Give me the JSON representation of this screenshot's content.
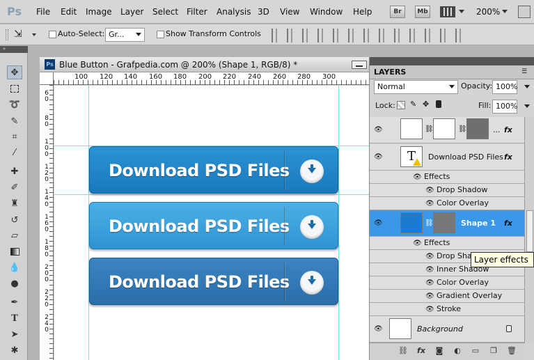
{
  "app": {
    "logo": "Ps"
  },
  "menu": [
    "File",
    "Edit",
    "Image",
    "Layer",
    "Select",
    "Filter",
    "Analysis",
    "3D",
    "View",
    "Window",
    "Help"
  ],
  "menubar_right": {
    "bridge": "Br",
    "minibridge": "Mb",
    "zoom": "200%"
  },
  "options": {
    "auto_select_label": "Auto-Select:",
    "auto_select_value": "Gr...",
    "show_transform_label": "Show Transform Controls"
  },
  "document": {
    "title": "Blue Button - Grafpedia.com @ 200% (Shape 1, RGB/8) *",
    "ruler_top": [
      "100",
      "120",
      "140",
      "160",
      "180",
      "200",
      "220",
      "240",
      "260",
      "280",
      "300"
    ],
    "ruler_left": [
      [
        "6",
        "0"
      ],
      [
        "8",
        "0"
      ],
      [
        "1",
        "0",
        "0"
      ],
      [
        "1",
        "2",
        "0"
      ],
      [
        "1",
        "4",
        "0"
      ],
      [
        "1",
        "6",
        "0"
      ],
      [
        "1",
        "8",
        "0"
      ],
      [
        "2",
        "0",
        "0"
      ],
      [
        "2",
        "2",
        "0"
      ],
      [
        "2",
        "4",
        "0"
      ]
    ],
    "button_label": "Download PSD Files"
  },
  "layers_panel": {
    "tab": "LAYERS",
    "blend_mode": "Normal",
    "opacity_label": "Opacity:",
    "opacity": "100%",
    "lock_label": "Lock:",
    "fill_label": "Fill:",
    "fill": "100%",
    "rows": {
      "group_ellipsis": "...",
      "text_layer": "Download PSD Files",
      "effects": "Effects",
      "drop_shadow": "Drop Shadow",
      "color_overlay": "Color Overlay",
      "shape_layer": "Shape 1",
      "effects2": "Effects",
      "drop_shadow2": "Drop Shadow",
      "inner_shadow": "Inner Shadow",
      "color_overlay2": "Color Overlay",
      "gradient_overlay": "Gradient Overlay",
      "stroke": "Stroke",
      "background": "Background"
    },
    "fx": "fx",
    "tooltip": "Layer effects"
  },
  "colors": {
    "selection": "#3b98e8",
    "button_blue_1": "#1e86c8",
    "button_blue_2": "#3aa1dc",
    "button_blue_3": "#2c79b8",
    "guide": "#6fe8e8"
  }
}
